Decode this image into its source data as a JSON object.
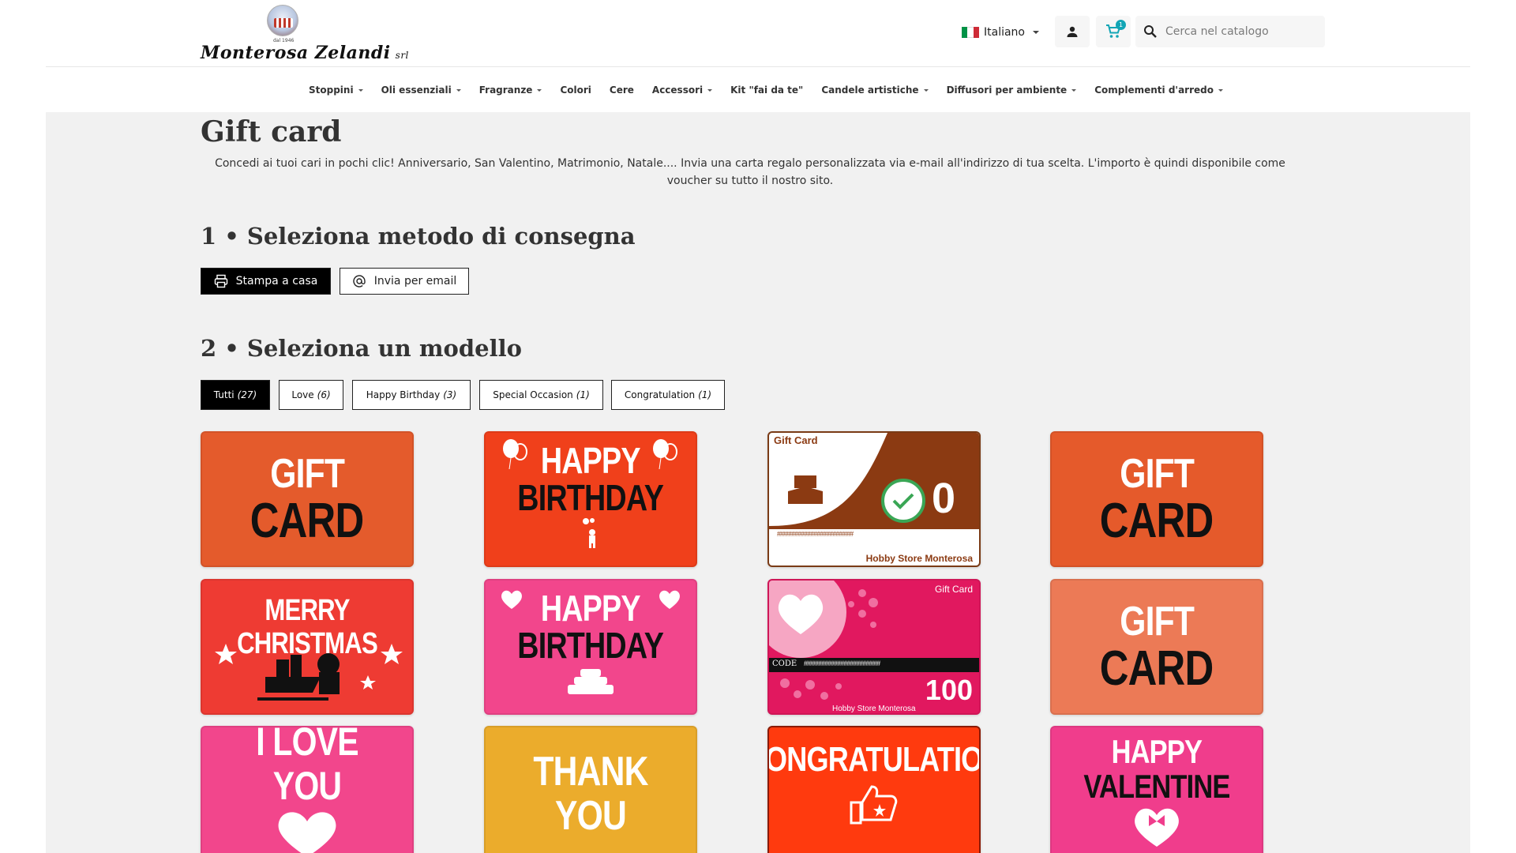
{
  "header": {
    "logo": {
      "brand": "Monterosa Zelandi",
      "suffix": "srl",
      "since": "dal 1946"
    },
    "language": {
      "label": "Italiano",
      "flag_colors": [
        "#009246",
        "#ffffff",
        "#ce2b37"
      ]
    },
    "cart_count": "1",
    "search_placeholder": "Cerca nel catalogo"
  },
  "nav": [
    {
      "label": "Stoppini",
      "dropdown": true
    },
    {
      "label": "Oli essenziali",
      "dropdown": true
    },
    {
      "label": "Fragranze",
      "dropdown": true
    },
    {
      "label": "Colori",
      "dropdown": false
    },
    {
      "label": "Cere",
      "dropdown": false
    },
    {
      "label": "Accessori",
      "dropdown": true
    },
    {
      "label": "Kit \"fai da te\"",
      "dropdown": false
    },
    {
      "label": "Candele artistiche",
      "dropdown": true
    },
    {
      "label": "Diffusori per ambiente",
      "dropdown": true
    },
    {
      "label": "Complementi d'arredo",
      "dropdown": true
    }
  ],
  "page": {
    "title": "Gift card",
    "description": "Concedi ai tuoi cari in pochi clic! Anniversario, San Valentino, Matrimonio, Natale.... Invia una carta regalo personalizzata via e-mail all'indirizzo di tua scelta. L'importo è quindi disponibile come voucher su tutto il nostro sito.",
    "step1_title": "1 • Seleziona metodo di consegna",
    "delivery": {
      "print_label": "Stampa a casa",
      "email_label": "Invia per email",
      "selected": "Stampa a casa"
    },
    "step2_title": "2 • Seleziona un modello",
    "filters": [
      {
        "label": "Tutti",
        "count": "(27)",
        "active": true
      },
      {
        "label": "Love",
        "count": "(6)",
        "active": false
      },
      {
        "label": "Happy Birthday",
        "count": "(3)",
        "active": false
      },
      {
        "label": "Special Occasion",
        "count": "(1)",
        "active": false
      },
      {
        "label": "Congratulation",
        "count": "(1)",
        "active": false
      }
    ]
  },
  "cards": {
    "c1": {
      "line1": "GIFT",
      "line2": "CARD",
      "bg": "#e45b2c"
    },
    "c2": {
      "line1": "HAPPY",
      "line2": "BIRTHDAY",
      "bg": "#f0401b"
    },
    "c3": {
      "label": "Gift Card",
      "amount": "0",
      "code": "########################",
      "store": "Hobby Store Monterosa",
      "accent": "#8b3a12"
    },
    "c4": {
      "line1": "GIFT",
      "line2": "CARD",
      "bg": "#e55a2b"
    },
    "c5": {
      "line1": "MERRY CHRISTMAS",
      "bg": "#ee3b33"
    },
    "c6": {
      "line1": "HAPPY",
      "line2": "BIRTHDAY",
      "bg": "#f2468c"
    },
    "c7": {
      "label": "Gift Card",
      "code_label": "CODE",
      "code": "########################",
      "amount": "100",
      "store": "Hobby Store Monterosa",
      "bg": "#e1185f"
    },
    "c8": {
      "line1": "GIFT",
      "line2": "CARD",
      "bg": "#ec7a56"
    },
    "c9": {
      "line1": "I LOVE YOU",
      "bg": "#f2468c"
    },
    "c10": {
      "line1": "THANK YOU",
      "bg": "#ebac2c"
    },
    "c11": {
      "line1": "CONGRATULATION",
      "bg": "#ff3a0e"
    },
    "c12": {
      "line1": "HAPPY",
      "line2": "VALENTINE",
      "bg": "#f03d8c"
    }
  }
}
